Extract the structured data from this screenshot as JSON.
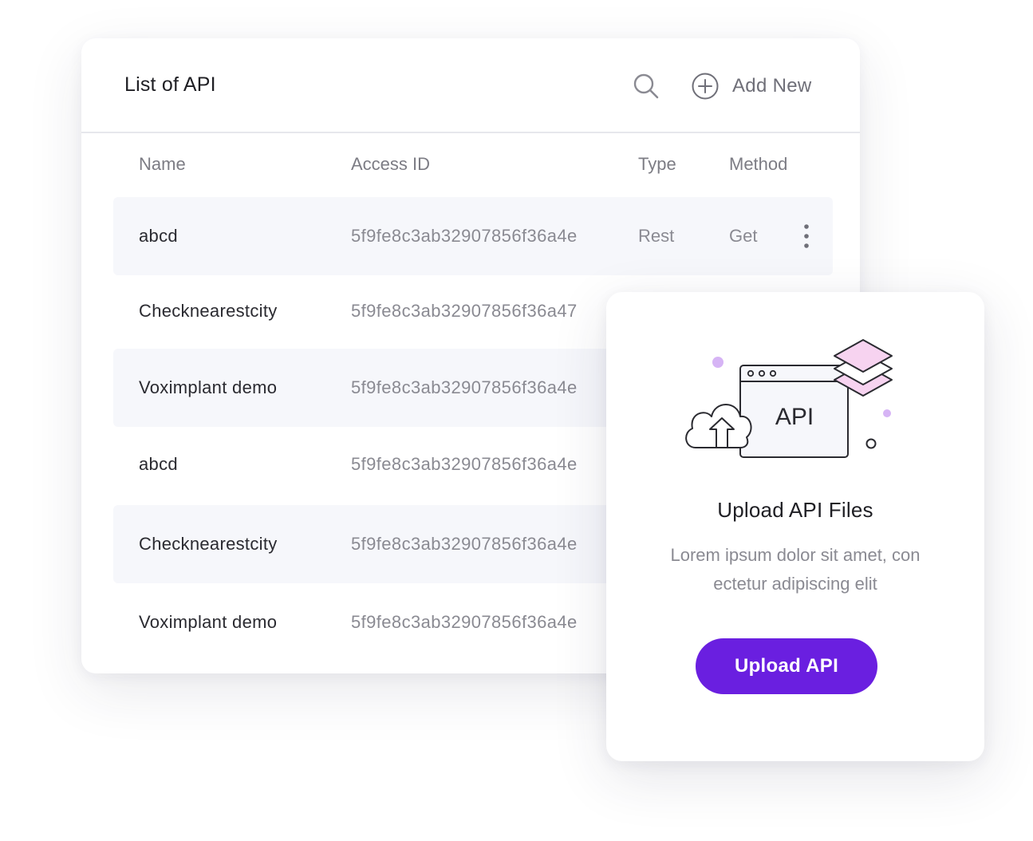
{
  "header": {
    "title": "List of API",
    "search_icon": "search-icon",
    "add_new_label": "Add New",
    "add_new_icon": "plus-circle-icon"
  },
  "table": {
    "columns": {
      "name": "Name",
      "access_id": "Access ID",
      "type": "Type",
      "method": "Method"
    },
    "rows": [
      {
        "name": "abcd",
        "access_id": "5f9fe8c3ab32907856f36a4e",
        "type": "Rest",
        "method": "Get"
      },
      {
        "name": "Checknearestcity",
        "access_id": "5f9fe8c3ab32907856f36a47"
      },
      {
        "name": "Voximplant demo",
        "access_id": "5f9fe8c3ab32907856f36a4e"
      },
      {
        "name": "abcd",
        "access_id": "5f9fe8c3ab32907856f36a4e"
      },
      {
        "name": "Checknearestcity",
        "access_id": "5f9fe8c3ab32907856f36a4e"
      },
      {
        "name": "Voximplant demo",
        "access_id": "5f9fe8c3ab32907856f36a4e"
      }
    ],
    "row_menu_icon": "more-vertical-icon"
  },
  "upload": {
    "illustration_label": "API",
    "title": "Upload API Files",
    "description_line1": "Lorem ipsum dolor sit amet, con",
    "description_line2": "ectetur adipiscing elit",
    "button_label": "Upload API"
  },
  "colors": {
    "accent": "#6a1fe0",
    "row_shade": "#f6f7fb",
    "layer_pink": "#f7d3f0",
    "dot_purple": "#d6b4f5"
  }
}
